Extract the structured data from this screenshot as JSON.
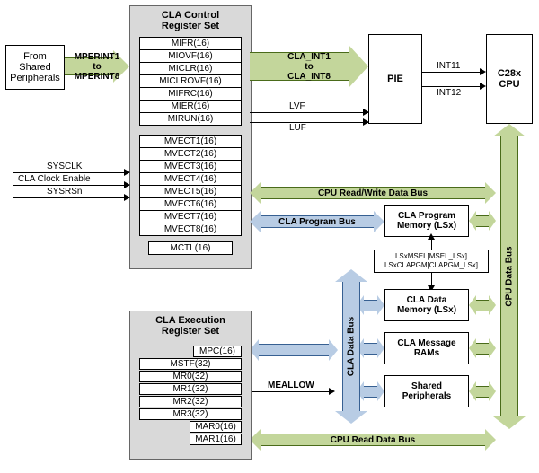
{
  "from_periph": "From\nShared\nPeripherals",
  "mperint": "MPERINT1\nto\nMPERINT8",
  "cla_ctrl_title": "CLA Control\nRegister Set",
  "ctrl_regs_a": [
    "MIFR(16)",
    "MIOVF(16)",
    "MICLR(16)",
    "MICLROVF(16)",
    "MIFRC(16)",
    "MIER(16)",
    "MIRUN(16)"
  ],
  "ctrl_regs_b": [
    "MVECT1(16)",
    "MVECT2(16)",
    "MVECT3(16)",
    "MVECT4(16)",
    "MVECT5(16)",
    "MVECT6(16)",
    "MVECT7(16)",
    "MVECT8(16)"
  ],
  "mctl": "MCTL(16)",
  "cla_int": "CLA_INT1\nto\nCLA_INT8",
  "pie": "PIE",
  "int11": "INT11",
  "int12": "INT12",
  "cpu": "C28x\nCPU",
  "lvf": "LVF",
  "luf": "LUF",
  "sysclk": "SYSCLK",
  "cla_clk_en": "CLA Clock Enable",
  "sysrsn": "SYSRSn",
  "cpu_rw_bus": "CPU Read/Write Data Bus",
  "cla_prog_bus": "CLA Program Bus",
  "cla_prog_mem": "CLA Program\nMemory (LSx)",
  "lsx_sel": "LSxMSEL[MSEL_LSx]\nLSxCLAPGM[CLAPGM_LSx]",
  "cla_data_mem": "CLA Data\nMemory (LSx)",
  "cla_msg_ram": "CLA Message\nRAMs",
  "shared_periph": "Shared\nPeripherals",
  "mealow": "MEALLOW",
  "cla_data_bus": "CLA Data Bus",
  "cpu_data_bus": "CPU Data Bus",
  "cpu_read_bus": "CPU Read Data Bus",
  "exec_title": "CLA Execution\nRegister Set",
  "exec_regs": {
    "mpc": "MPC(16)",
    "mstf": "MSTF(32)",
    "mr0": "MR0(32)",
    "mr1": "MR1(32)",
    "mr2": "MR2(32)",
    "mr3": "MR3(32)",
    "mar0": "MAR0(16)",
    "mar1": "MAR1(16)"
  }
}
